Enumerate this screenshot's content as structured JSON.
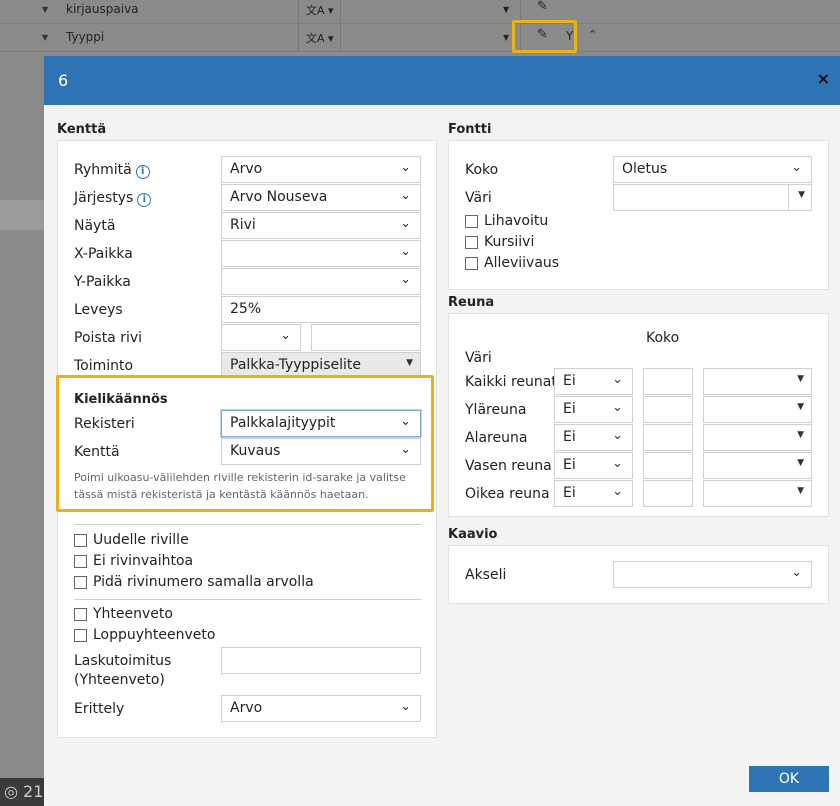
{
  "background": {
    "rows": [
      {
        "label": "kirjauspaiva",
        "translate_icon": "文A ▾"
      },
      {
        "label": "Tyyppi",
        "translate_icon": "文A ▾"
      }
    ],
    "bottom_text": "21"
  },
  "dialog": {
    "title": "6",
    "close": "×",
    "ok_label": "OK",
    "left": {
      "section_title": "Kenttä",
      "rows": [
        {
          "label": "Ryhmitä",
          "info": "i",
          "value": "Arvo"
        },
        {
          "label": "Järjestys",
          "info": "i",
          "value": "Arvo Nouseva"
        },
        {
          "label": "Näytä",
          "value": "Rivi"
        },
        {
          "label": "X-Paikka",
          "value": ""
        },
        {
          "label": "Y-Paikka",
          "value": ""
        },
        {
          "label": "Leveys",
          "value": "25%"
        },
        {
          "label": "Poista rivi",
          "value": ""
        },
        {
          "label": "Toiminto",
          "value": "Palkka-Tyyppiselite"
        }
      ],
      "translation": {
        "title": "Kielikäännös",
        "rekisteri_label": "Rekisteri",
        "rekisteri_value": "Palkkalajityypit",
        "kentta_label": "Kenttä",
        "kentta_value": "Kuvaus",
        "hint": "Poimi ulkoasu-välilehden riville rekisterin id-sarake ja valitse tässä mistä rekisteristä ja kentästä käännös haetaan. TRANSLATE_MISSING"
      },
      "checks1": [
        "Uudelle riville",
        "Ei rivinvaihtoa",
        "Pidä rivinumero samalla arvolla"
      ],
      "checks2": [
        "Yhteenveto",
        "Loppuyhteenveto"
      ],
      "laskutoimitus_label1": "Laskutoimitus",
      "laskutoimitus_label2": "(Yhteenveto)",
      "erittely_label": "Erittely",
      "erittely_value": "Arvo"
    },
    "right": {
      "fontti": {
        "title": "Fontti",
        "koko_label": "Koko",
        "koko_value": "Oletus",
        "vari_label": "Väri",
        "checks": [
          "Lihavoitu",
          "Kursiivi",
          "Alleviivaus"
        ]
      },
      "reuna": {
        "title": "Reuna",
        "koko_header": "Koko",
        "vari_header": "Väri",
        "rows": [
          {
            "label": "Kaikki reunat",
            "value": "Ei"
          },
          {
            "label": "Yläreuna",
            "value": "Ei"
          },
          {
            "label": "Alareuna",
            "value": "Ei"
          },
          {
            "label": "Vasen reuna",
            "value": "Ei"
          },
          {
            "label": "Oikea reuna",
            "value": "Ei"
          }
        ]
      },
      "kaavio": {
        "title": "Kaavio",
        "akseli_label": "Akseli",
        "akseli_value": ""
      }
    }
  }
}
